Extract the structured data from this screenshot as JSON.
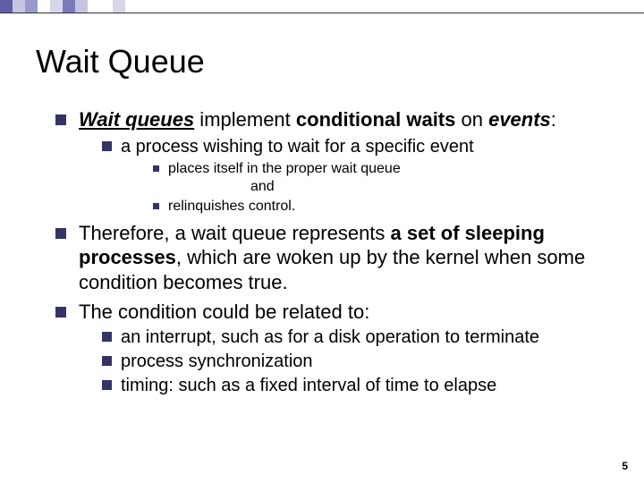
{
  "title": "Wait Queue",
  "b1": {
    "seg1": "Wait queues",
    "seg2": " implement ",
    "seg3": "conditional waits",
    "seg4": " on ",
    "seg5": "events",
    "seg6": ":"
  },
  "b1_1": "a process wishing to wait for a specific event",
  "b1_1_1": "places itself in the proper wait queue",
  "b1_1_and": "and",
  "b1_1_2": "relinquishes control.",
  "b2": {
    "seg1": "Therefore, a wait queue represents ",
    "seg2": "a set of sleeping processes",
    "seg3": ", which are woken up by the kernel when some condition becomes true."
  },
  "b3": "The condition could be related to:",
  "b3_1": "an interrupt, such as for a disk operation to terminate",
  "b3_2": "process synchronization",
  "b3_3": "timing: such as a fixed interval of time to elapse",
  "pagenum": "5"
}
